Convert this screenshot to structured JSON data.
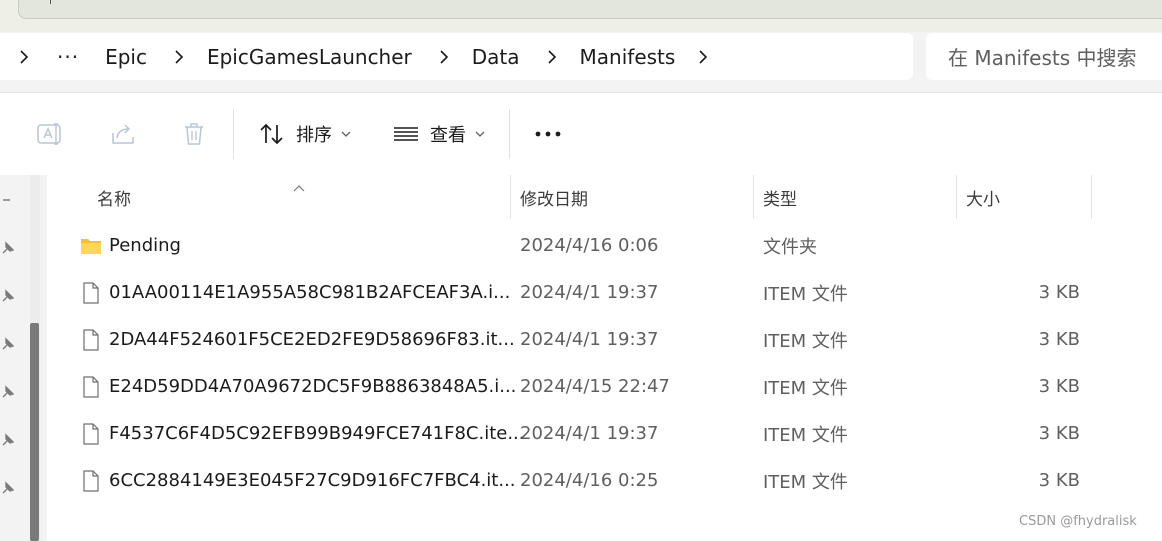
{
  "address_bar": {
    "crumbs": [
      "Epic",
      "EpicGamesLauncher",
      "Data",
      "Manifests"
    ],
    "overflow": "···",
    "search_placeholder": "在 Manifests 中搜索"
  },
  "toolbar": {
    "rename_icon": "rename-icon",
    "share_icon": "share-icon",
    "delete_icon": "delete-icon",
    "sort_label": "排序",
    "view_label": "查看",
    "more_icon": "more-icon"
  },
  "columns": {
    "name": "名称",
    "date": "修改日期",
    "type": "类型",
    "size": "大小"
  },
  "rows": [
    {
      "name": "Pending",
      "date": "2024/4/16 0:06",
      "type": "文件夹",
      "size": "",
      "icon": "folder-icon"
    },
    {
      "name": "01AA00114E1A955A58C981B2AFCEAF3A.i...",
      "date": "2024/4/1 19:37",
      "type": "ITEM 文件",
      "size": "3 KB",
      "icon": "file-icon"
    },
    {
      "name": "2DA44F524601F5CE2ED2FE9D58696F83.it...",
      "date": "2024/4/1 19:37",
      "type": "ITEM 文件",
      "size": "3 KB",
      "icon": "file-icon"
    },
    {
      "name": "E24D59DD4A70A9672DC5F9B8863848A5.i...",
      "date": "2024/4/15 22:47",
      "type": "ITEM 文件",
      "size": "3 KB",
      "icon": "file-icon"
    },
    {
      "name": "F4537C6F4D5C92EFB99B949FCE741F8C.ite...",
      "date": "2024/4/1 19:37",
      "type": "ITEM 文件",
      "size": "3 KB",
      "icon": "file-icon"
    },
    {
      "name": "6CC2884149E3E045F27C9D916FC7FBC4.it...",
      "date": "2024/4/16 0:25",
      "type": "ITEM 文件",
      "size": "3 KB",
      "icon": "file-icon"
    }
  ],
  "watermark": "CSDN @fhydralisk",
  "colors": {
    "folder": "#f4c034",
    "accent": "#0067c0",
    "muted_text": "#5f5f5f"
  }
}
